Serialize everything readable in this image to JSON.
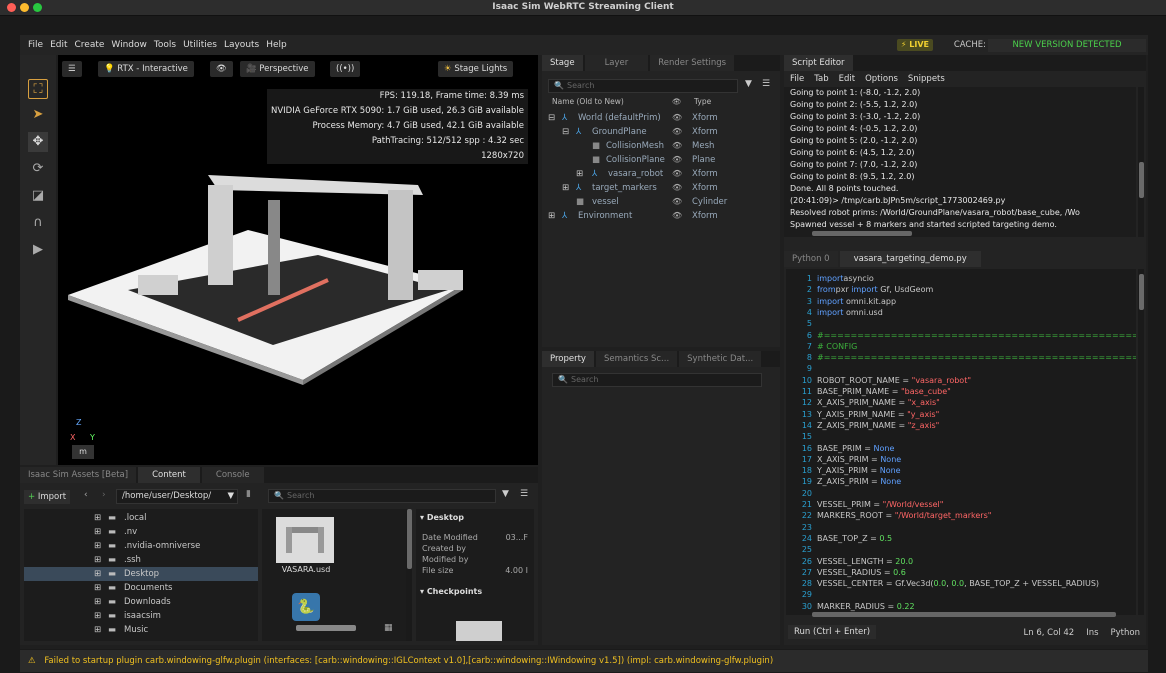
{
  "window_title": "Isaac Sim WebRTC Streaming Client",
  "menu": [
    "File",
    "Edit",
    "Create",
    "Window",
    "Tools",
    "Utilities",
    "Layouts",
    "Help"
  ],
  "live_label": "⚡ LIVE",
  "cache_label": "CACHE:",
  "new_version": "NEW VERSION DETECTED",
  "viewport": {
    "renderer": "RTX - Interactive",
    "camera": "Perspective",
    "lights": "Stage Lights",
    "stats": [
      "FPS: 119.18, Frame time: 8.39 ms",
      "NVIDIA GeForce RTX 5090: 1.7 GiB used, 26.3 GiB available",
      "Process Memory: 4.7 GiB used, 42.1 GiB available",
      "PathTracing: 512/512 spp : 4.32 sec",
      "1280x720"
    ],
    "unit": "m"
  },
  "stage": {
    "tabs": [
      "Stage",
      "Layer",
      "Render Settings"
    ],
    "search_placeholder": "Search",
    "col_name": "Name (Old to New)",
    "col_type": "Type",
    "rows": [
      {
        "name": "World (defaultPrim)",
        "type": "Xform"
      },
      {
        "name": "GroundPlane",
        "type": "Xform"
      },
      {
        "name": "CollisionMesh",
        "type": "Mesh"
      },
      {
        "name": "CollisionPlane",
        "type": "Plane"
      },
      {
        "name": "vasara_robot",
        "type": "Xform"
      },
      {
        "name": "target_markers",
        "type": "Xform"
      },
      {
        "name": "vessel",
        "type": "Cylinder"
      },
      {
        "name": "Environment",
        "type": "Xform"
      }
    ]
  },
  "property": {
    "tabs": [
      "Property",
      "Semantics Sc...",
      "Synthetic Dat..."
    ],
    "search_placeholder": "Search"
  },
  "script_editor": {
    "title": "Script Editor",
    "menu": [
      "File",
      "Tab",
      "Edit",
      "Options",
      "Snippets"
    ],
    "log": [
      "Going to point 1: (-8.0, -1.2, 2.0)",
      "Going to point 2: (-5.5, 1.2, 2.0)",
      "Going to point 3: (-3.0, -1.2, 2.0)",
      "Going to point 4: (-0.5, 1.2, 2.0)",
      "Going to point 5: (2.0, -1.2, 2.0)",
      "Going to point 6: (4.5, 1.2, 2.0)",
      "Going to point 7: (7.0, -1.2, 2.0)",
      "Going to point 8: (9.5, 1.2, 2.0)",
      "Done. All 8 points touched.",
      "(20:41:09)> /tmp/carb.bJPn5m/script_1773002469.py",
      "Resolved robot prims: /World/GroundPlane/vasara_robot/base_cube, /Wo",
      "Spawned vessel + 8 markers and started scripted targeting demo."
    ],
    "tabs": [
      "Python 0",
      "vasara_targeting_demo.py"
    ],
    "run_label": "Run (Ctrl + Enter)",
    "cursor_pos": "Ln 6, Col 42",
    "mode": "Ins",
    "language": "Python",
    "code": [
      {
        "n": "1",
        "parts": [
          [
            "kw",
            "import"
          ],
          [
            "",
            "asyncio"
          ]
        ]
      },
      {
        "n": "2",
        "parts": [
          [
            "kw",
            "from"
          ],
          [
            "",
            "pxr "
          ],
          [
            "kw",
            "import"
          ],
          [
            "",
            " Gf, UsdGeom"
          ]
        ]
      },
      {
        "n": "3",
        "parts": [
          [
            "kw",
            "import"
          ],
          [
            "",
            " omni.kit.app"
          ]
        ]
      },
      {
        "n": "4",
        "parts": [
          [
            "kw",
            "import"
          ],
          [
            "",
            " omni.usd"
          ]
        ]
      },
      {
        "n": "5",
        "parts": []
      },
      {
        "n": "6",
        "parts": [
          [
            "cm",
            "#===================================================================="
          ]
        ]
      },
      {
        "n": "7",
        "parts": [
          [
            "cm",
            "# CONFIG"
          ]
        ]
      },
      {
        "n": "8",
        "parts": [
          [
            "cm",
            "#===================================================================="
          ]
        ]
      },
      {
        "n": "9",
        "parts": []
      },
      {
        "n": "10",
        "parts": [
          [
            "",
            "ROBOT_ROOT_NAME = "
          ],
          [
            "str",
            "\"vasara_robot\""
          ]
        ]
      },
      {
        "n": "11",
        "parts": [
          [
            "",
            "BASE_PRIM_NAME = "
          ],
          [
            "str",
            "\"base_cube\""
          ]
        ]
      },
      {
        "n": "12",
        "parts": [
          [
            "",
            "X_AXIS_PRIM_NAME = "
          ],
          [
            "str",
            "\"x_axis\""
          ]
        ]
      },
      {
        "n": "13",
        "parts": [
          [
            "",
            "Y_AXIS_PRIM_NAME = "
          ],
          [
            "str",
            "\"y_axis\""
          ]
        ]
      },
      {
        "n": "14",
        "parts": [
          [
            "",
            "Z_AXIS_PRIM_NAME = "
          ],
          [
            "str",
            "\"z_axis\""
          ]
        ]
      },
      {
        "n": "15",
        "parts": []
      },
      {
        "n": "16",
        "parts": [
          [
            "",
            "BASE_PRIM = "
          ],
          [
            "kw",
            "None"
          ]
        ]
      },
      {
        "n": "17",
        "parts": [
          [
            "",
            "X_AXIS_PRIM = "
          ],
          [
            "kw",
            "None"
          ]
        ]
      },
      {
        "n": "18",
        "parts": [
          [
            "",
            "Y_AXIS_PRIM = "
          ],
          [
            "kw",
            "None"
          ]
        ]
      },
      {
        "n": "19",
        "parts": [
          [
            "",
            "Z_AXIS_PRIM = "
          ],
          [
            "kw",
            "None"
          ]
        ]
      },
      {
        "n": "20",
        "parts": []
      },
      {
        "n": "21",
        "parts": [
          [
            "",
            "VESSEL_PRIM = "
          ],
          [
            "str",
            "\"/World/vessel\""
          ]
        ]
      },
      {
        "n": "22",
        "parts": [
          [
            "",
            "MARKERS_ROOT = "
          ],
          [
            "str",
            "\"/World/target_markers\""
          ]
        ]
      },
      {
        "n": "23",
        "parts": []
      },
      {
        "n": "24",
        "parts": [
          [
            "",
            "BASE_TOP_Z = "
          ],
          [
            "num",
            "0.5"
          ]
        ]
      },
      {
        "n": "25",
        "parts": []
      },
      {
        "n": "26",
        "parts": [
          [
            "",
            "VESSEL_LENGTH = "
          ],
          [
            "num",
            "20.0"
          ]
        ]
      },
      {
        "n": "27",
        "parts": [
          [
            "",
            "VESSEL_RADIUS = "
          ],
          [
            "num",
            "0.6"
          ]
        ]
      },
      {
        "n": "28",
        "parts": [
          [
            "",
            "VESSEL_CENTER = Gf.Vec3d("
          ],
          [
            "num",
            "0.0"
          ],
          [
            "",
            ", "
          ],
          [
            "num",
            "0.0"
          ],
          [
            "",
            ", BASE_TOP_Z + VESSEL_RADIUS)"
          ]
        ]
      },
      {
        "n": "29",
        "parts": []
      },
      {
        "n": "30",
        "parts": [
          [
            "",
            "MARKER_RADIUS = "
          ],
          [
            "num",
            "0.22"
          ]
        ]
      }
    ]
  },
  "content": {
    "tabs": [
      "Isaac Sim Assets [Beta]",
      "Content",
      "Console"
    ],
    "import_label": "Import",
    "path": "/home/user/Desktop/",
    "search_placeholder": "Search",
    "tree": [
      ".local",
      ".nv",
      ".nvidia-omniverse",
      ".ssh",
      "Desktop",
      "Documents",
      "Downloads",
      "isaacsim",
      "Music"
    ],
    "file_name": "VASARA.usd",
    "details_title": "Desktop",
    "details": [
      {
        "k": "Date Modified",
        "v": "03...F"
      },
      {
        "k": "Created by",
        "v": ""
      },
      {
        "k": "Modified by",
        "v": ""
      },
      {
        "k": "File size",
        "v": "4.00 I"
      }
    ],
    "checkpoints": "Checkpoints"
  },
  "status": "Failed to startup plugin carb.windowing-glfw.plugin (interfaces: [carb::windowing::IGLContext v1.0],[carb::windowing::IWindowing v1.5]) (impl: carb.windowing-glfw.plugin)"
}
